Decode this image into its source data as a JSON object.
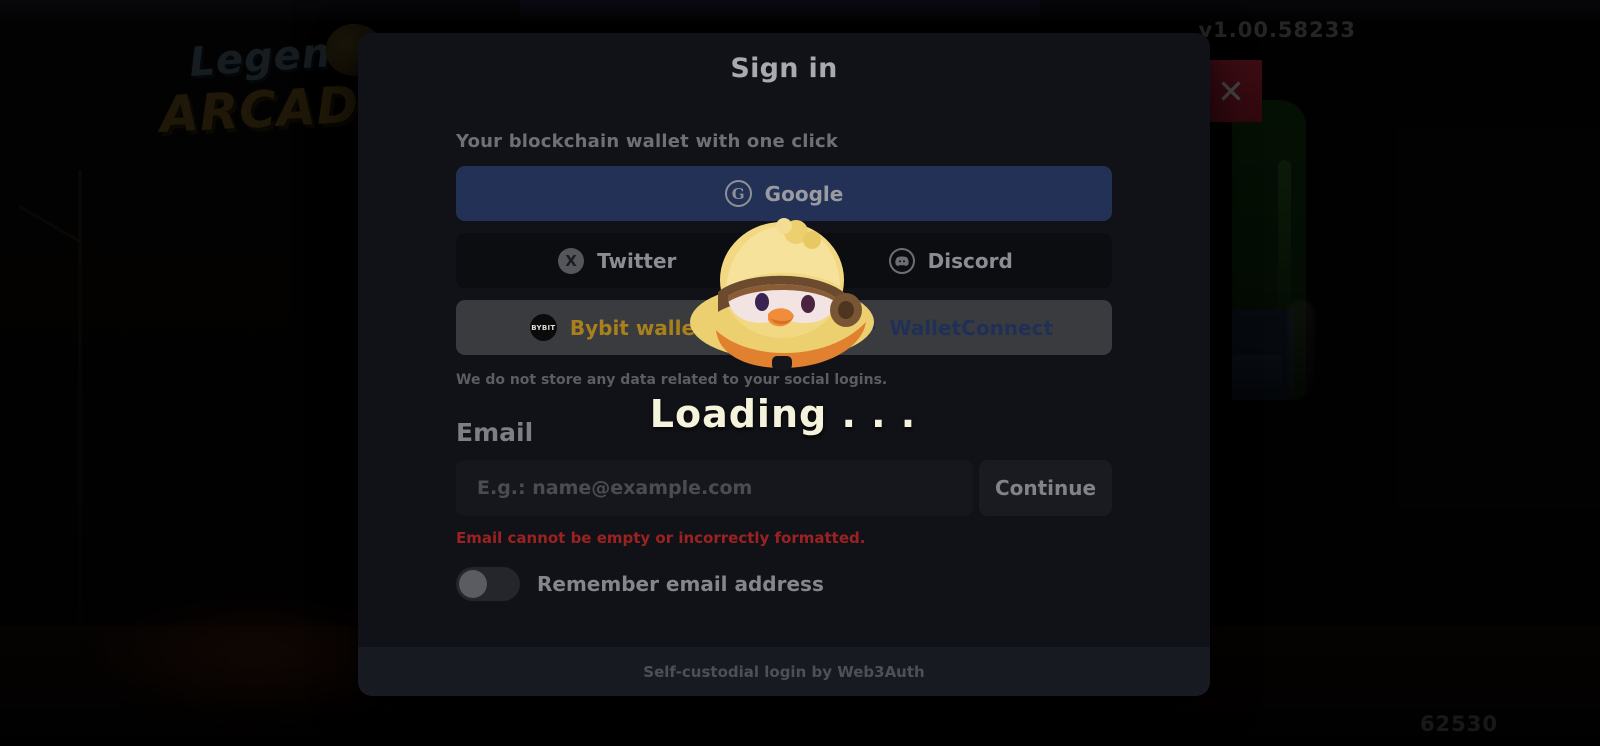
{
  "background": {
    "game_logo": {
      "line1": "Legend",
      "line2": "ARCADIA",
      "mascot_icon": "duck-mascot-icon"
    },
    "version": "v1.00.58233",
    "frame_counter": "62530",
    "close_button": {
      "icon": "close-icon",
      "glyph": "✕",
      "color": "#b4243a"
    }
  },
  "modal": {
    "title": "Sign in",
    "wallet_section_label": "Your blockchain wallet with one click",
    "buttons": {
      "google": {
        "label": "Google",
        "icon": "google-icon",
        "glyph": "G",
        "bg": "#243156"
      },
      "twitter": {
        "label": "Twitter",
        "icon": "twitter-x-icon",
        "glyph": "𝕏",
        "bg": "#0c0d11"
      },
      "discord": {
        "label": "Discord",
        "icon": "discord-icon",
        "bg": "#0c0d11"
      },
      "bybit": {
        "label": "Bybit wallet",
        "icon": "bybit-icon",
        "glyph": "BYBIT",
        "bg": "#3a3b3f",
        "color": "#a8801c"
      },
      "walletconnect": {
        "label": "WalletConnect",
        "icon": "walletconnect-icon",
        "bg": "#3a3b3f",
        "color": "#1f3057"
      }
    },
    "privacy_note": "We do not store any data related to your social logins.",
    "email": {
      "label": "Email",
      "value": "",
      "placeholder": "E.g.: name@example.com",
      "continue_label": "Continue",
      "error": "Email cannot be empty or incorrectly formatted."
    },
    "remember": {
      "label": "Remember email address",
      "enabled": false
    },
    "footer": "Self-custodial login by Web3Auth"
  },
  "loading": {
    "text": "Loading . . .",
    "mascot_icon": "chick-aviator-mascot-icon"
  }
}
